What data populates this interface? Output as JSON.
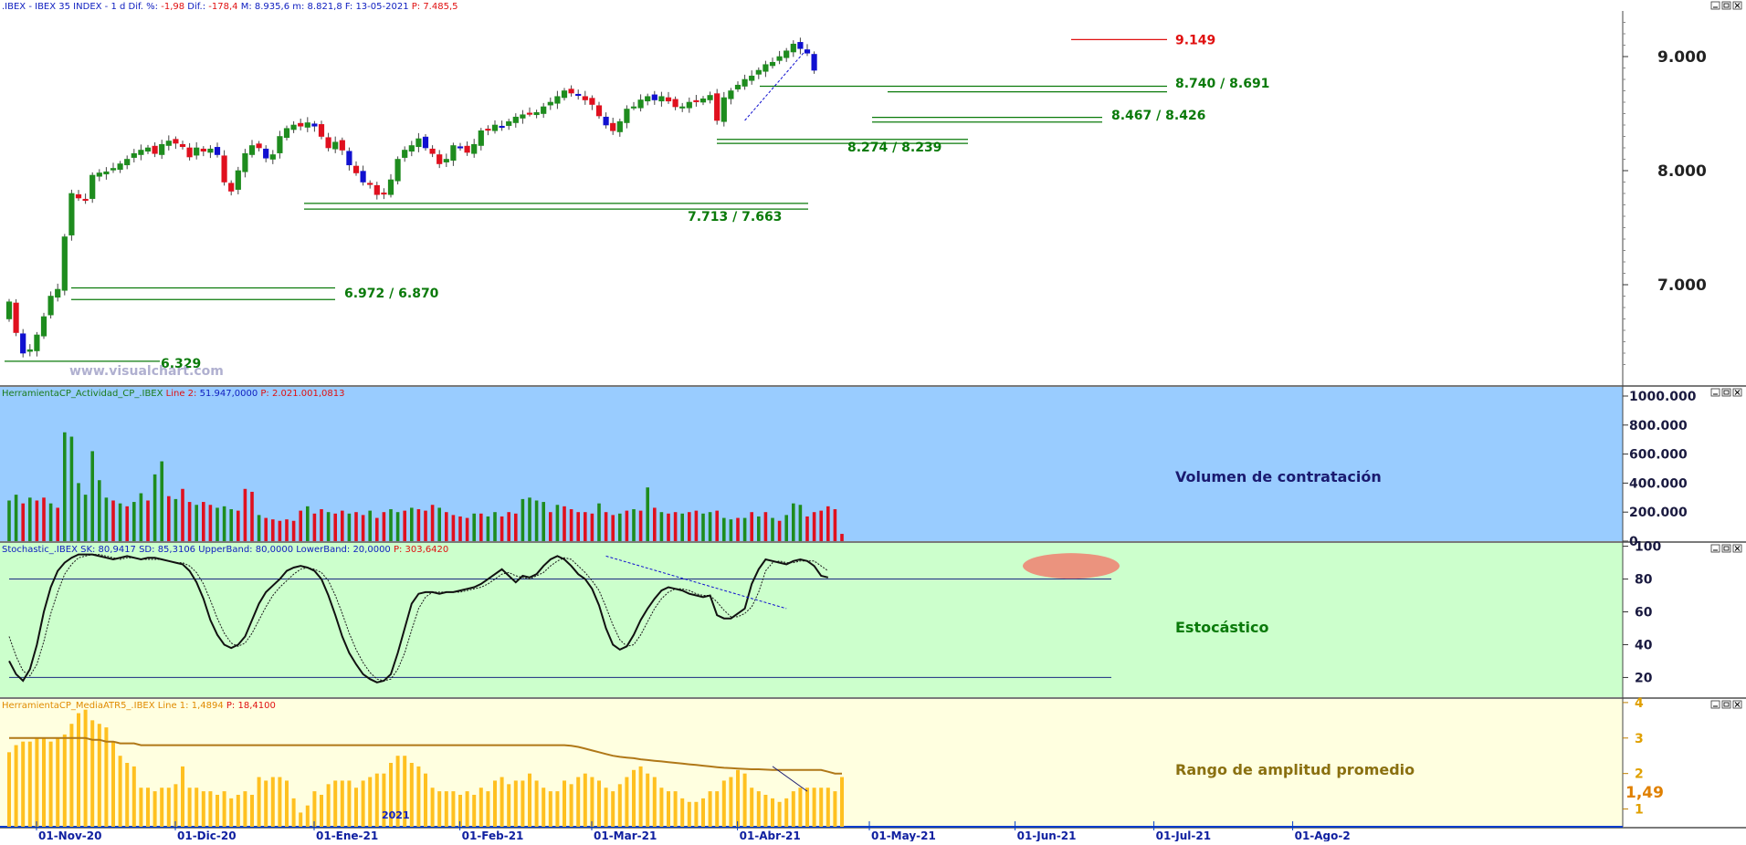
{
  "header": {
    "symbol": ".IBEX - IBEX 35 INDEX - ",
    "period": "1 d",
    "dif_pct_label": "Dif. %:",
    "dif_pct_value": "-1,98",
    "dif_label": "Dif.:",
    "dif_value": "-178,4",
    "max_label": "M:",
    "max_value": "8.935,6",
    "min_label": "m:",
    "min_value": "8.821,8",
    "date_label": "F:",
    "date_value": "13-05-2021",
    "p_label": "P:",
    "p_value": "7.485,5"
  },
  "watermark": "www.visualchart.com",
  "colors": {
    "up_candle": "#1e8c1e",
    "down_candle": "#e0101e",
    "blue_candle": "#1010d0",
    "level_line": "#0a7a0a",
    "resistance": "#e01010",
    "volume_bg": "#99ccff",
    "stoch_bg": "#ccffcc",
    "atr_bg": "#ffffe0",
    "atr_bar": "#ffc020",
    "atr_avg": "#b07818",
    "stoch_ellipse": "#f08070"
  },
  "chart_data": [
    {
      "type": "candlestick",
      "name": "price",
      "y_ticks": [
        "9.000",
        "8.000",
        "7.000"
      ],
      "y_tick_values": [
        9000,
        8000,
        7000
      ],
      "ylim": [
        6120,
        9400
      ],
      "x_tick_labels": [
        "01-Nov-20",
        "01-Dic-20",
        "01-Ene-21",
        "01-Feb-21",
        "01-Mar-21",
        "01-Abr-21",
        "01-May-21",
        "01-Jun-21",
        "01-Jul-21",
        "01-Ago-2"
      ],
      "x_tick_bar_index": [
        0,
        20,
        40,
        61,
        80,
        101,
        120,
        141,
        161,
        181
      ],
      "close": [
        6850,
        6580,
        6400,
        6430,
        6560,
        6720,
        6900,
        6960,
        7420,
        7800,
        7760,
        7740,
        7960,
        7980,
        7990,
        8020,
        8060,
        8100,
        8150,
        8180,
        8200,
        8150,
        8230,
        8260,
        8240,
        8210,
        8120,
        8200,
        8170,
        8190,
        8140,
        7900,
        7820,
        8000,
        8150,
        8220,
        8200,
        8110,
        8140,
        8300,
        8370,
        8400,
        8390,
        8420,
        8390,
        8300,
        8200,
        8250,
        8180,
        8050,
        7980,
        7900,
        7880,
        7790,
        7800,
        7920,
        8100,
        8180,
        8220,
        8280,
        8200,
        8150,
        8060,
        8100,
        8220,
        8200,
        8160,
        8230,
        8350,
        8360,
        8400,
        8380,
        8430,
        8470,
        8490,
        8500,
        8510,
        8560,
        8600,
        8650,
        8700,
        8680,
        8660,
        8620,
        8580,
        8480,
        8400,
        8350,
        8430,
        8540,
        8560,
        8620,
        8650,
        8620,
        8650,
        8610,
        8560,
        8560,
        8600,
        8610,
        8630,
        8660,
        8440,
        8640,
        8700,
        8750,
        8800,
        8830,
        8880,
        8930,
        8950,
        9000,
        9050,
        9110,
        9070,
        9030,
        8880
      ],
      "labels": [
        {
          "text": "9.149",
          "value": 9149,
          "color": "red"
        },
        {
          "text": "8.740 / 8.691",
          "values": [
            8740,
            8691
          ]
        },
        {
          "text": "8.467 / 8.426",
          "values": [
            8467,
            8426
          ]
        },
        {
          "text": "8.274 / 8.239",
          "values": [
            8274,
            8239
          ]
        },
        {
          "text": "7.713 / 7.663",
          "values": [
            7713,
            7663
          ]
        },
        {
          "text": "6.972 / 6.870",
          "values": [
            6972,
            6870
          ]
        },
        {
          "text": "6.329",
          "values": [
            6329
          ]
        }
      ]
    },
    {
      "type": "bar",
      "name": "volume",
      "title": "HerramientaCP_Actividad_CP_.IBEX",
      "line_label": "Line 2:",
      "line_value": "51.947,0000",
      "p_label": "P:",
      "p_value": "2.021.001,0813",
      "annotation": "Volumen de contratación",
      "y_ticks": [
        "1000.000",
        "800.000",
        "600.000",
        "400.000",
        "200.000",
        "0"
      ],
      "y_tick_values": [
        1000000,
        800000,
        600000,
        400000,
        200000,
        0
      ],
      "ylim": [
        0,
        1000000
      ],
      "values": [
        280000,
        320000,
        260000,
        300000,
        280000,
        300000,
        260000,
        230000,
        750000,
        720000,
        400000,
        320000,
        620000,
        420000,
        300000,
        280000,
        260000,
        240000,
        270000,
        330000,
        280000,
        460000,
        550000,
        310000,
        290000,
        360000,
        270000,
        250000,
        270000,
        250000,
        230000,
        240000,
        220000,
        210000,
        360000,
        340000,
        180000,
        160000,
        150000,
        140000,
        150000,
        140000,
        210000,
        240000,
        190000,
        220000,
        200000,
        190000,
        210000,
        190000,
        200000,
        180000,
        210000,
        160000,
        200000,
        220000,
        200000,
        210000,
        230000,
        220000,
        210000,
        250000,
        230000,
        200000,
        180000,
        170000,
        160000,
        190000,
        190000,
        170000,
        200000,
        170000,
        200000,
        190000,
        290000,
        300000,
        280000,
        270000,
        200000,
        250000,
        240000,
        220000,
        200000,
        200000,
        190000,
        260000,
        200000,
        180000,
        190000,
        210000,
        220000,
        210000,
        370000,
        230000,
        200000,
        190000,
        200000,
        190000,
        200000,
        210000,
        190000,
        200000,
        210000,
        160000,
        150000,
        160000,
        160000,
        200000,
        170000,
        200000,
        160000,
        140000,
        180000,
        260000,
        250000,
        170000,
        200000,
        210000,
        240000,
        220000,
        50000
      ],
      "up": [
        1,
        1,
        0,
        1,
        0,
        0,
        1,
        0,
        1,
        1,
        1,
        1,
        1,
        1,
        1,
        0,
        1,
        0,
        1,
        1,
        0,
        1,
        1,
        0,
        1,
        0,
        0,
        1,
        0,
        0,
        1,
        1,
        1,
        0,
        0,
        0,
        1,
        0,
        0,
        0,
        0,
        0,
        0,
        1,
        0,
        0,
        1,
        0,
        0,
        1,
        0,
        0,
        1,
        0,
        0,
        1,
        1,
        0,
        1,
        0,
        0,
        0,
        1,
        0,
        0,
        0,
        0,
        1,
        0,
        1,
        1,
        0,
        0,
        0,
        1,
        1,
        1,
        1,
        0,
        1,
        0,
        0,
        0,
        0,
        0,
        1,
        0,
        0,
        1,
        0,
        1,
        0,
        1,
        0,
        1,
        0,
        0,
        1,
        0,
        0,
        1,
        1,
        0,
        1,
        1,
        0,
        1,
        0,
        1,
        0,
        1,
        0,
        1,
        1,
        1,
        0,
        0,
        0,
        0,
        0,
        0
      ]
    },
    {
      "type": "line",
      "name": "stochastic",
      "title": "Stochastic_.IBEX",
      "sk_label": "SK:",
      "sk_value": "80,9417",
      "sd_label": "SD:",
      "sd_value": "85,3106",
      "upper_label": "UpperBand:",
      "upper_value": "80,0000",
      "lower_label": "LowerBand:",
      "lower_value": "20,0000",
      "p_label": "P:",
      "p_value": "303,6420",
      "annotation": "Estocástico",
      "y_ticks": [
        "100",
        "80",
        "60",
        "40",
        "20"
      ],
      "y_tick_values": [
        100,
        80,
        60,
        40,
        20
      ],
      "ylim": [
        8,
        102
      ],
      "bands": [
        80,
        20
      ],
      "sk": [
        30,
        22,
        18,
        25,
        40,
        60,
        75,
        85,
        90,
        93,
        95,
        95,
        95,
        94,
        93,
        92,
        93,
        94,
        93,
        92,
        93,
        93,
        92,
        91,
        90,
        89,
        85,
        78,
        68,
        55,
        46,
        40,
        38,
        40,
        45,
        55,
        65,
        72,
        76,
        80,
        85,
        87,
        88,
        87,
        85,
        80,
        70,
        58,
        45,
        35,
        28,
        22,
        19,
        17,
        18,
        22,
        35,
        50,
        65,
        71,
        72,
        72,
        71,
        72,
        72,
        73,
        74,
        75,
        77,
        80,
        83,
        86,
        82,
        78,
        82,
        81,
        83,
        88,
        92,
        94,
        92,
        88,
        83,
        80,
        74,
        64,
        50,
        40,
        37,
        39,
        46,
        55,
        62,
        68,
        73,
        75,
        74,
        73,
        71,
        70,
        69,
        70,
        58,
        56,
        56,
        59,
        62,
        77,
        86,
        92,
        91,
        90,
        89,
        91,
        92,
        91,
        88,
        82,
        81
      ],
      "sd": [
        45,
        33,
        24,
        21,
        28,
        42,
        59,
        72,
        83,
        89,
        93,
        94,
        95,
        95,
        94,
        93,
        92,
        93,
        93,
        92,
        92,
        92,
        92,
        91,
        90,
        90,
        88,
        84,
        77,
        67,
        56,
        47,
        41,
        39,
        41,
        47,
        55,
        63,
        70,
        75,
        79,
        83,
        86,
        87,
        86,
        84,
        79,
        70,
        59,
        47,
        37,
        29,
        23,
        19,
        18,
        19,
        25,
        35,
        49,
        62,
        69,
        72,
        72,
        72,
        72,
        72,
        73,
        74,
        75,
        77,
        80,
        83,
        84,
        82,
        81,
        80,
        82,
        84,
        88,
        91,
        93,
        92,
        88,
        84,
        79,
        73,
        63,
        52,
        43,
        39,
        40,
        46,
        54,
        62,
        68,
        72,
        74,
        74,
        73,
        71,
        70,
        70,
        66,
        61,
        57,
        57,
        59,
        63,
        72,
        85,
        90,
        91,
        90,
        90,
        91,
        91,
        91,
        88,
        85
      ],
      "trend": {
        "from_bar": 86,
        "from_value": 94,
        "to_bar": 112,
        "to_value": 62
      }
    },
    {
      "type": "bar",
      "name": "atr",
      "title": "HerramientaCP_MediaATR5_.IBEX",
      "line_label": "Line 1:",
      "line_value": "1,4894",
      "p_label": "P:",
      "p_value": "18,4100",
      "annotation": "Rango de amplitud promedio",
      "value_label": "1,49",
      "year_label": "2021",
      "y_ticks": [
        "4",
        "3",
        "2",
        "1"
      ],
      "y_tick_values": [
        4,
        3,
        2,
        1
      ],
      "ylim": [
        0.5,
        4.1
      ],
      "values": [
        2.6,
        2.8,
        2.9,
        2.9,
        3.0,
        3.0,
        2.9,
        3.0,
        3.1,
        3.4,
        3.7,
        3.8,
        3.5,
        3.4,
        3.3,
        2.9,
        2.5,
        2.3,
        2.2,
        1.6,
        1.6,
        1.5,
        1.6,
        1.6,
        1.7,
        2.2,
        1.6,
        1.6,
        1.5,
        1.5,
        1.4,
        1.5,
        1.3,
        1.4,
        1.5,
        1.4,
        1.9,
        1.8,
        1.9,
        1.9,
        1.8,
        1.3,
        0.9,
        1.1,
        1.5,
        1.4,
        1.7,
        1.8,
        1.8,
        1.8,
        1.6,
        1.8,
        1.9,
        2.0,
        2.0,
        2.3,
        2.5,
        2.5,
        2.3,
        2.2,
        2.0,
        1.6,
        1.5,
        1.5,
        1.5,
        1.4,
        1.5,
        1.4,
        1.6,
        1.5,
        1.8,
        1.9,
        1.7,
        1.8,
        1.8,
        2.0,
        1.8,
        1.6,
        1.5,
        1.5,
        1.8,
        1.7,
        1.9,
        2.0,
        1.9,
        1.8,
        1.6,
        1.5,
        1.7,
        1.9,
        2.1,
        2.2,
        2.0,
        1.9,
        1.6,
        1.5,
        1.5,
        1.3,
        1.2,
        1.2,
        1.3,
        1.5,
        1.5,
        1.8,
        1.9,
        2.1,
        2.0,
        1.6,
        1.5,
        1.4,
        1.3,
        1.2,
        1.3,
        1.5,
        1.6,
        1.6,
        1.6,
        1.6,
        1.6,
        1.5,
        1.9
      ],
      "average": [
        3.0,
        3.0,
        3.0,
        3.0,
        3.0,
        3.0,
        3.0,
        3.0,
        3.0,
        3.0,
        3.0,
        3.0,
        2.95,
        2.95,
        2.9,
        2.9,
        2.85,
        2.85,
        2.85,
        2.8,
        2.8,
        2.8,
        2.8,
        2.8,
        2.8,
        2.8,
        2.8,
        2.8,
        2.8,
        2.8,
        2.8,
        2.8,
        2.8,
        2.8,
        2.8,
        2.8,
        2.8,
        2.8,
        2.8,
        2.8,
        2.8,
        2.8,
        2.8,
        2.8,
        2.8,
        2.8,
        2.8,
        2.8,
        2.8,
        2.8,
        2.8,
        2.8,
        2.8,
        2.8,
        2.8,
        2.8,
        2.8,
        2.8,
        2.8,
        2.8,
        2.8,
        2.8,
        2.8,
        2.8,
        2.8,
        2.8,
        2.8,
        2.8,
        2.8,
        2.8,
        2.8,
        2.8,
        2.8,
        2.8,
        2.8,
        2.8,
        2.8,
        2.8,
        2.8,
        2.8,
        2.8,
        2.78,
        2.75,
        2.7,
        2.65,
        2.6,
        2.55,
        2.5,
        2.47,
        2.45,
        2.43,
        2.4,
        2.38,
        2.36,
        2.34,
        2.32,
        2.3,
        2.28,
        2.26,
        2.24,
        2.22,
        2.2,
        2.18,
        2.16,
        2.15,
        2.14,
        2.13,
        2.12,
        2.12,
        2.11,
        2.1,
        2.1,
        2.1,
        2.1,
        2.1,
        2.1,
        2.1,
        2.1,
        2.05,
        2.0,
        2.0
      ],
      "trend": {
        "from_bar": 110,
        "from_value": 2.2,
        "to_bar": 115,
        "to_value": 1.5
      }
    }
  ]
}
